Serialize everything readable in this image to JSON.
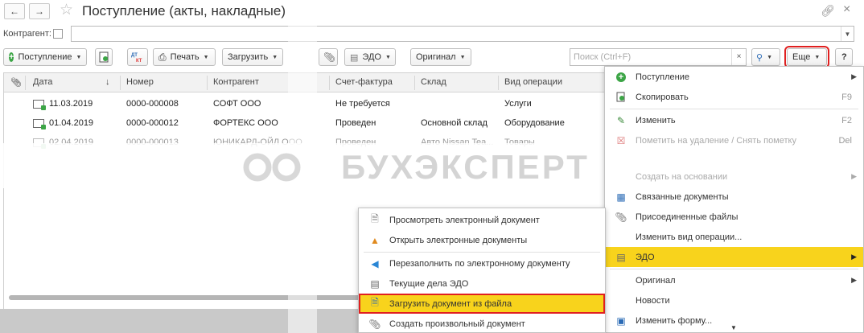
{
  "window": {
    "title": "Поступление (акты, накладные)"
  },
  "filter": {
    "counterparty_label": "Контрагент:"
  },
  "toolbar": {
    "receipt_label": "Поступление",
    "print_label": "Печать",
    "load_label": "Загрузить",
    "edo_label": "ЭДО",
    "original_label": "Оригинал",
    "search_placeholder": "Поиск (Ctrl+F)",
    "more_label": "Еще",
    "help_label": "?",
    "dt_kt_label": "Дт Кт"
  },
  "table": {
    "columns": [
      "Дата",
      "Номер",
      "Контрагент",
      "Счет-фактура",
      "Склад",
      "Вид операции"
    ],
    "rows": [
      {
        "date": "11.03.2019",
        "number": "0000-000008",
        "counterparty": "СОФТ ООО",
        "invoice": "Не требуется",
        "warehouse": "",
        "operation": "Услуги"
      },
      {
        "date": "01.04.2019",
        "number": "0000-000012",
        "counterparty": "ФОРТЕКС ООО",
        "invoice": "Проведен",
        "warehouse": "Основной склад",
        "operation": "Оборудование"
      },
      {
        "date": "02.04.2019",
        "number": "0000-000013",
        "counterparty": "ЮНИКАРД-ОЙЛ ООО",
        "invoice": "Проведен",
        "warehouse": "Авто Nissan Tea...",
        "operation": "Товары"
      }
    ]
  },
  "watermark": "БУХЭКСПЕРТ",
  "more_menu": {
    "items": [
      {
        "label": "Поступление",
        "icon": "green-plus-icon",
        "submenu": true
      },
      {
        "label": "Скопировать",
        "shortcut": "F9",
        "icon": "copy-icon"
      },
      {
        "label": "Изменить",
        "shortcut": "F2",
        "icon": "pencil-icon"
      },
      {
        "label": "Пометить на удаление / Снять пометку",
        "shortcut": "Del",
        "icon": "delete-mark-icon"
      },
      {
        "label": "Создать на основании",
        "submenu": true,
        "disabled": true
      },
      {
        "label": "Связанные документы",
        "icon": "related-docs-icon"
      },
      {
        "label": "Присоединенные файлы",
        "icon": "paperclip-icon"
      },
      {
        "label": "Изменить вид операции...",
        "icon": ""
      },
      {
        "label": "ЭДО",
        "icon": "edo-icon",
        "submenu": true,
        "selected": true
      },
      {
        "label": "Оригинал",
        "submenu": true
      },
      {
        "label": "Новости"
      },
      {
        "label": "Изменить форму...",
        "icon": "form-icon"
      }
    ]
  },
  "edo_menu": {
    "items": [
      {
        "label": "Просмотреть электронный документ",
        "icon": "document-icon"
      },
      {
        "label": "Открыть электронные документы",
        "icon": "org-tree-icon"
      },
      {
        "label": "Перезаполнить по электронному документу",
        "icon": "refill-arrow-icon"
      },
      {
        "label": "Текущие дела ЭДО",
        "icon": "tasks-icon"
      },
      {
        "label": "Загрузить документ из файла",
        "icon": "load-file-icon",
        "highlighted": true
      },
      {
        "label": "Создать произвольный документ",
        "icon": "paperclip-icon"
      }
    ]
  },
  "colors": {
    "highlight_yellow": "#f8d31c",
    "red_outline": "#e02020",
    "green_icon": "#3ca546"
  }
}
